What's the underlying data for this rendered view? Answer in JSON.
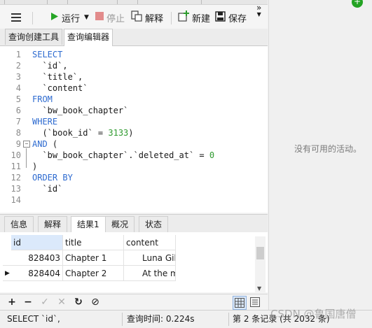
{
  "toolbar": {
    "run_label": "运行",
    "stop_label": "停止",
    "explain_label": "解释",
    "new_label": "新建",
    "save_label": "保存",
    "more_label": "»"
  },
  "query_tabs": [
    {
      "label": "查询创建工具",
      "active": false
    },
    {
      "label": "查询编辑器",
      "active": true
    }
  ],
  "editor": {
    "lines": [
      {
        "num": "1",
        "tokens": [
          {
            "t": "SELECT",
            "c": "kw"
          }
        ]
      },
      {
        "num": "2",
        "tokens": [
          {
            "t": "  `id`,",
            "c": ""
          }
        ]
      },
      {
        "num": "3",
        "tokens": [
          {
            "t": "  `title`,",
            "c": ""
          }
        ]
      },
      {
        "num": "4",
        "tokens": [
          {
            "t": "  `content`",
            "c": ""
          }
        ]
      },
      {
        "num": "5",
        "tokens": [
          {
            "t": "FROM",
            "c": "kw"
          }
        ]
      },
      {
        "num": "6",
        "tokens": [
          {
            "t": "  `bw_book_chapter`",
            "c": ""
          }
        ]
      },
      {
        "num": "7",
        "tokens": [
          {
            "t": "WHERE",
            "c": "kw"
          }
        ]
      },
      {
        "num": "8",
        "tokens": [
          {
            "t": "  (`book_id` = ",
            "c": ""
          },
          {
            "t": "3133",
            "c": "num"
          },
          {
            "t": ")",
            "c": ""
          }
        ]
      },
      {
        "num": "9",
        "tokens": [
          {
            "t": "AND",
            "c": "kw"
          },
          {
            "t": " (",
            "c": ""
          }
        ]
      },
      {
        "num": "10",
        "tokens": [
          {
            "t": "  `bw_book_chapter`.`deleted_at` = ",
            "c": ""
          },
          {
            "t": "0",
            "c": "num"
          }
        ]
      },
      {
        "num": "11",
        "tokens": [
          {
            "t": ")",
            "c": ""
          }
        ]
      },
      {
        "num": "12",
        "tokens": [
          {
            "t": "ORDER BY",
            "c": "kw"
          }
        ]
      },
      {
        "num": "13",
        "tokens": [
          {
            "t": "  `id`",
            "c": ""
          }
        ]
      },
      {
        "num": "14",
        "tokens": []
      }
    ]
  },
  "result_tabs": [
    {
      "label": "信息",
      "active": false
    },
    {
      "label": "解释",
      "active": false
    },
    {
      "label": "结果1",
      "active": true
    },
    {
      "label": "概况",
      "active": false
    },
    {
      "label": "状态",
      "active": false
    }
  ],
  "grid": {
    "columns": [
      "id",
      "title",
      "content"
    ],
    "rows": [
      [
        "828403",
        "Chapter 1",
        "Luna Gib"
      ],
      [
        "828404",
        "Chapter 2",
        "At the m"
      ]
    ]
  },
  "bottom_icons": [
    "plus-icon",
    "minus-icon",
    "check-icon",
    "cancel-icon",
    "refresh-icon",
    "stop-icon",
    "grid-view-icon",
    "form-view-icon"
  ],
  "status": {
    "sql": "SELECT `id`,",
    "query_time": "查询时间: 0.224s",
    "record_info": "第 2 条记录 (共 2032 条)"
  },
  "right_panel": {
    "message": "没有可用的活动。"
  },
  "watermark": "CSDN @鲁国唐僧"
}
